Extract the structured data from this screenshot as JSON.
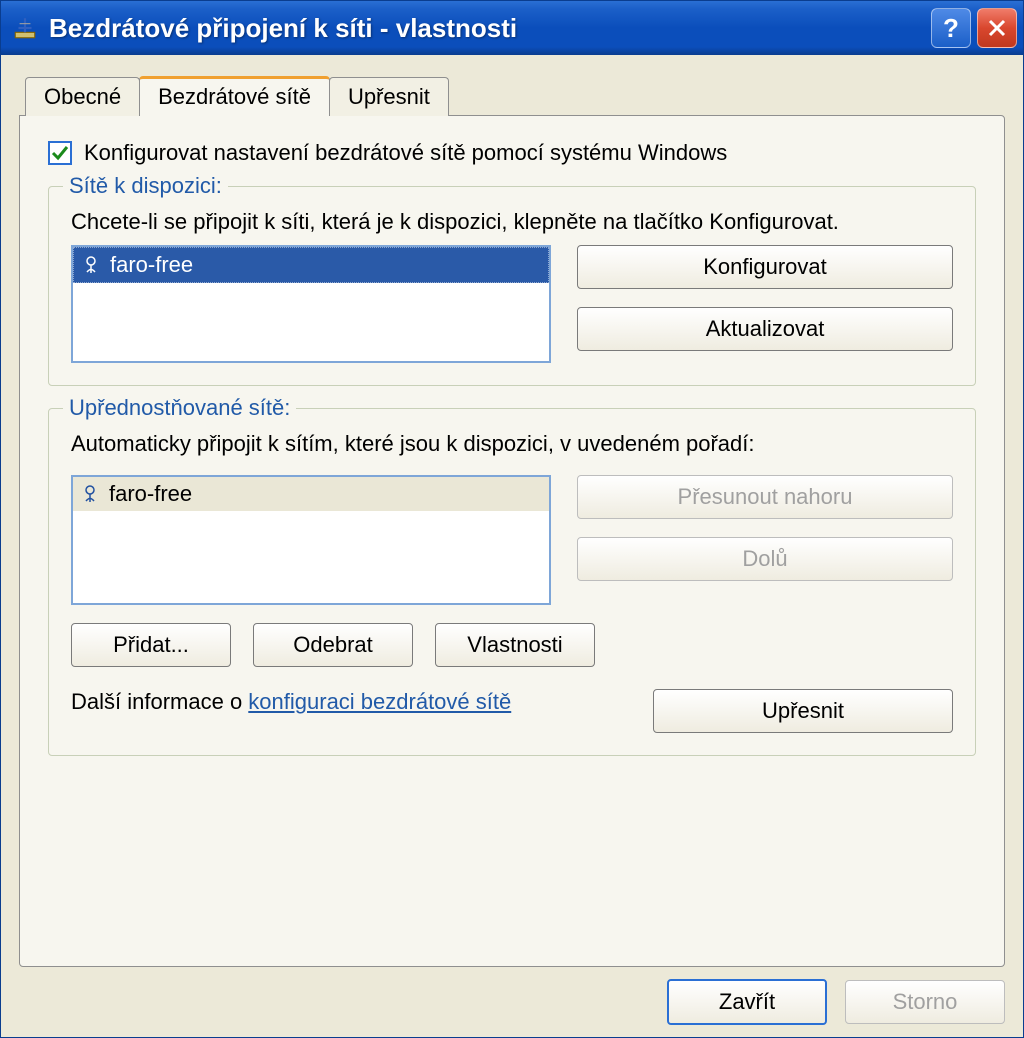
{
  "titlebar": {
    "title": "Bezdrátové připojení k síti - vlastnosti",
    "help_tooltip": "?",
    "close_tooltip": "X"
  },
  "tabs": {
    "general": "Obecné",
    "wireless": "Bezdrátové sítě",
    "advanced": "Upřesnit"
  },
  "checkbox_label": "Konfigurovat nastavení bezdrátové sítě pomocí systému Windows",
  "available": {
    "legend": "Sítě k dispozici:",
    "desc": "Chcete-li se připojit k síti, která je k dispozici, klepněte na tlačítko Konfigurovat.",
    "items": {
      "0": {
        "name": "faro-free"
      }
    },
    "configure_btn": "Konfigurovat",
    "refresh_btn": "Aktualizovat"
  },
  "preferred": {
    "legend": "Upřednostňované sítě:",
    "desc": "Automaticky připojit k sítím, které jsou k dispozici, v uvedeném pořadí:",
    "items": {
      "0": {
        "name": "faro-free"
      }
    },
    "moveup_btn": "Přesunout nahoru",
    "movedown_btn": "Dolů",
    "add_btn": "Přidat...",
    "remove_btn": "Odebrat",
    "properties_btn": "Vlastnosti",
    "info_prefix": "Další informace o ",
    "info_link": "konfiguraci bezdrátové sítě",
    "advanced_btn": "Upřesnit"
  },
  "bottom": {
    "close_btn": "Zavřít",
    "cancel_btn": "Storno"
  }
}
